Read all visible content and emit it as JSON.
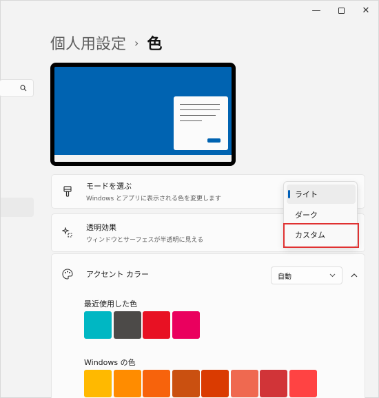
{
  "window": {
    "controls": {
      "minimize": "—",
      "close": "✕"
    }
  },
  "breadcrumb": {
    "parent": "個人用設定",
    "separator": "›",
    "current": "色"
  },
  "mode_card": {
    "title": "モードを選ぶ",
    "subtitle": "Windows とアプリに表示される色を変更します",
    "icon": "paintbrush-icon"
  },
  "transparency_card": {
    "title": "透明効果",
    "subtitle": "ウィンドウとサーフェスが半透明に見える",
    "icon": "sparkle-icon"
  },
  "mode_dropdown": {
    "options": [
      "ライト",
      "ダーク",
      "カスタム"
    ],
    "selected": "ライト",
    "highlighted": "カスタム"
  },
  "accent_card": {
    "title": "アクセント カラー",
    "select_value": "自動",
    "icon": "palette-icon",
    "recent_label": "最近使用した色",
    "recent_colors": [
      "#00b7c3",
      "#4c4a48",
      "#e81123",
      "#ea005e"
    ],
    "windows_label": "Windows の色",
    "windows_colors": [
      "#ffb900",
      "#ff8c00",
      "#f7630c",
      "#ca5010",
      "#da3b01",
      "#ef6950",
      "#d13438",
      "#ff4343"
    ]
  },
  "colors": {
    "accent": "#005fb8",
    "preview_desktop": "#0063b1",
    "highlight": "#e03131"
  }
}
